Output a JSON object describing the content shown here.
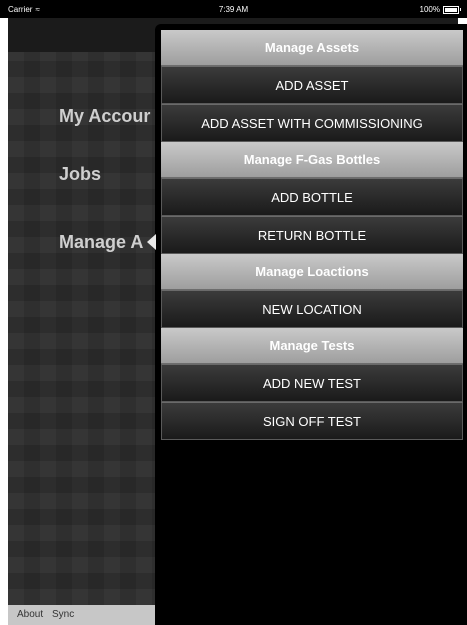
{
  "status_bar": {
    "carrier": "Carrier",
    "time": "7:39 AM",
    "battery": "100%"
  },
  "sidebar": {
    "items": [
      {
        "label": "My Accour"
      },
      {
        "label": "Jobs"
      },
      {
        "label": "Manage A"
      }
    ]
  },
  "bottom_bar": {
    "about": "About",
    "sync": "Sync"
  },
  "popover": {
    "sections": [
      {
        "header": "Manage Assets",
        "items": [
          "ADD ASSET",
          "ADD ASSET WITH COMMISSIONING"
        ]
      },
      {
        "header": "Manage F-Gas Bottles",
        "items": [
          "ADD BOTTLE",
          "RETURN BOTTLE"
        ]
      },
      {
        "header": "Manage Loactions",
        "items": [
          "NEW LOCATION"
        ]
      },
      {
        "header": "Manage Tests",
        "items": [
          "ADD NEW TEST",
          "SIGN OFF TEST"
        ]
      }
    ]
  }
}
